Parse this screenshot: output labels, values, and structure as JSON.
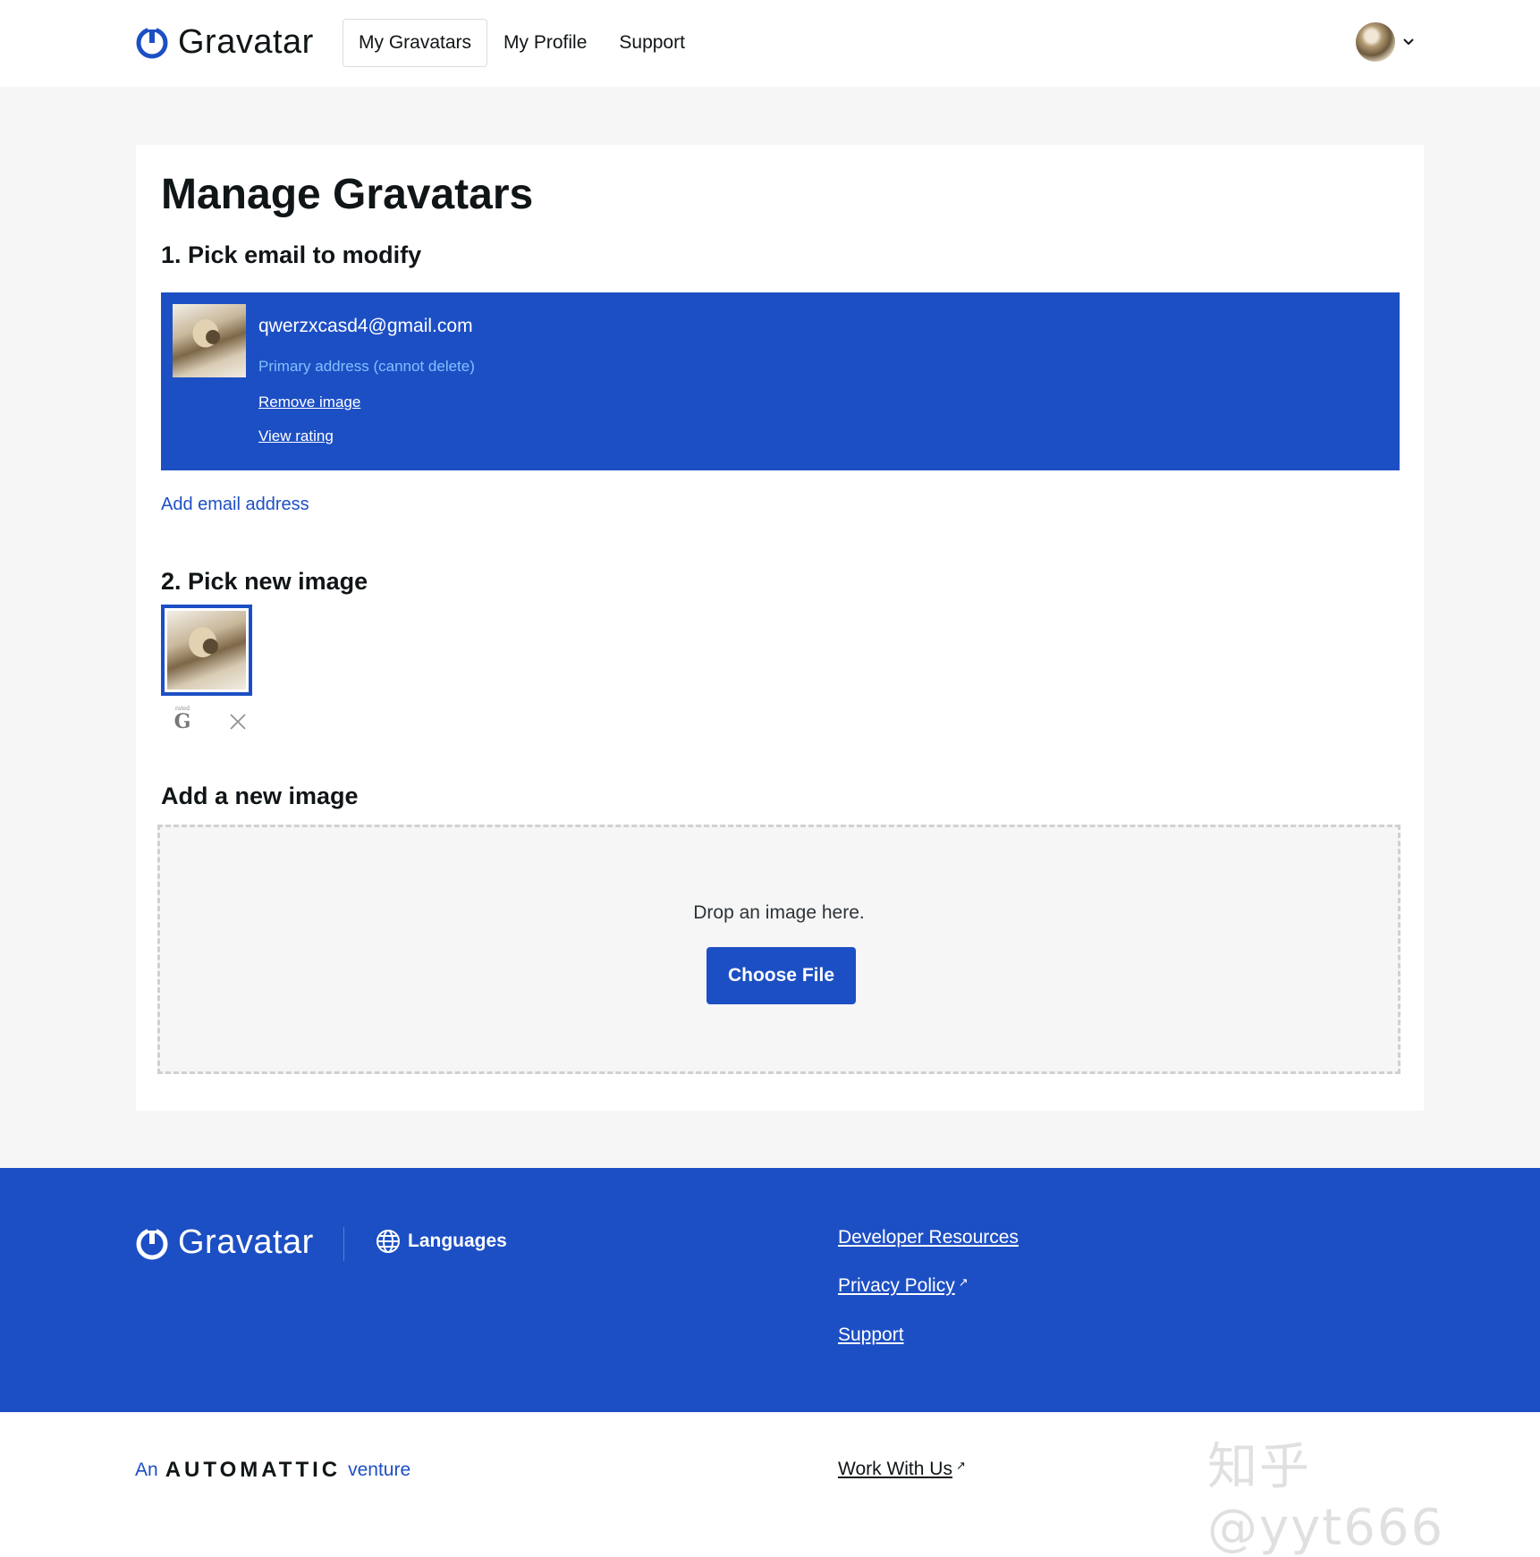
{
  "header": {
    "brand": "Gravatar",
    "nav": [
      {
        "label": "My Gravatars"
      },
      {
        "label": "My Profile"
      },
      {
        "label": "Support"
      }
    ]
  },
  "main": {
    "title": "Manage Gravatars",
    "step1_title": "1. Pick email to modify",
    "email": {
      "address": "qwerzxcasd4@gmail.com",
      "note": "Primary address (cannot delete)",
      "remove_link": "Remove image",
      "rating_link": "View rating"
    },
    "add_email": "Add email address",
    "step2_title": "2. Pick new image",
    "rating": {
      "small": "rated",
      "letter": "G"
    },
    "add_title": "Add a new image",
    "drop_text": "Drop an image here.",
    "choose_button": "Choose File"
  },
  "footer": {
    "brand": "Gravatar",
    "languages": "Languages",
    "links": [
      {
        "label": "Developer Resources"
      },
      {
        "label": "Privacy Policy"
      },
      {
        "label": "Support"
      }
    ],
    "venture_prefix": "An",
    "venture_brand": "AUTOMATTIC",
    "venture_suffix": "venture",
    "work_link": "Work With Us",
    "watermark": "知乎 @yyt666"
  },
  "colors": {
    "accent": "#1d4fc4",
    "light_blue_text": "#7fc1ff",
    "page_bg": "#f6f6f6"
  }
}
